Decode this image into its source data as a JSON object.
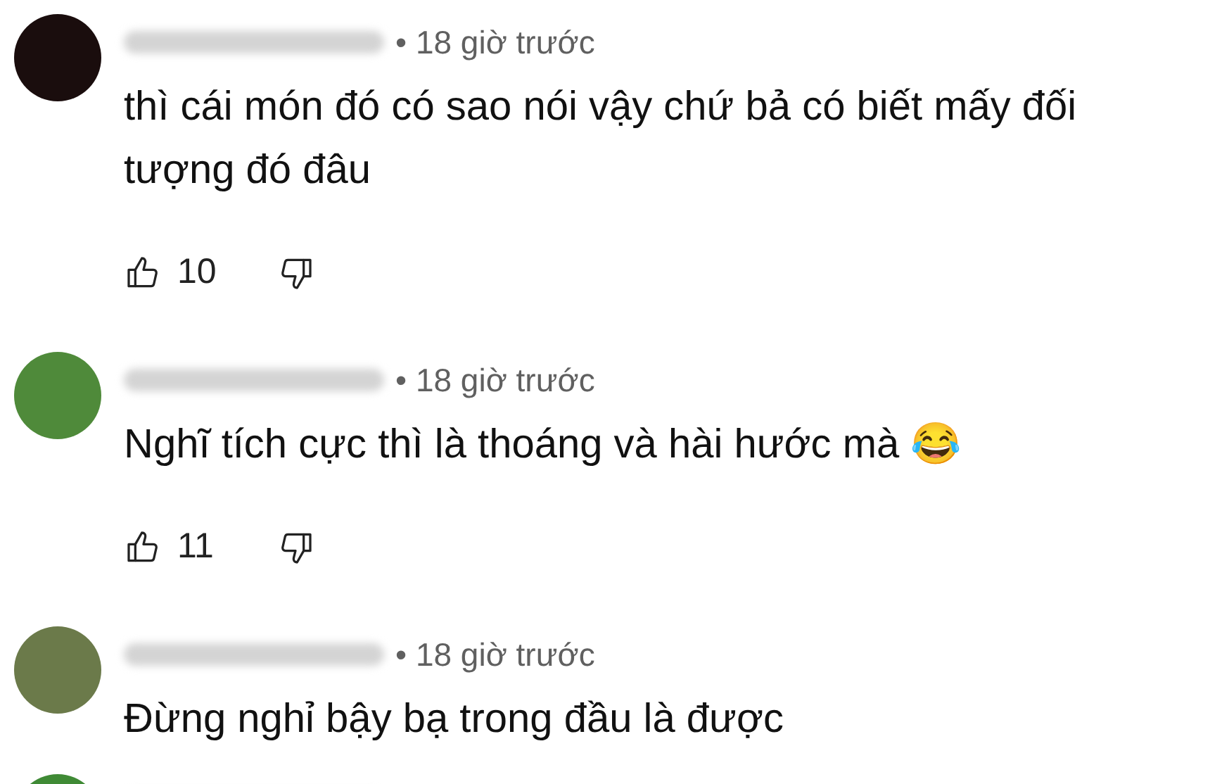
{
  "comments": [
    {
      "time": "• 18 giờ trước",
      "text": "thì cái món đó có sao nói vậy chứ bả có biết mấy đối tượng đó đâu",
      "likes": "10",
      "color": "#1a0d0d"
    },
    {
      "time": "• 18 giờ trước",
      "text": "Nghĩ tích cực thì là thoáng và hài hước mà 😂",
      "likes": "11",
      "color": "#4f8a3a"
    },
    {
      "time": "• 18 giờ trước",
      "text": "Đừng nghỉ bậy bạ trong đầu là được",
      "color": "#6b7a4a"
    },
    {
      "color": "#3f8a35"
    }
  ]
}
